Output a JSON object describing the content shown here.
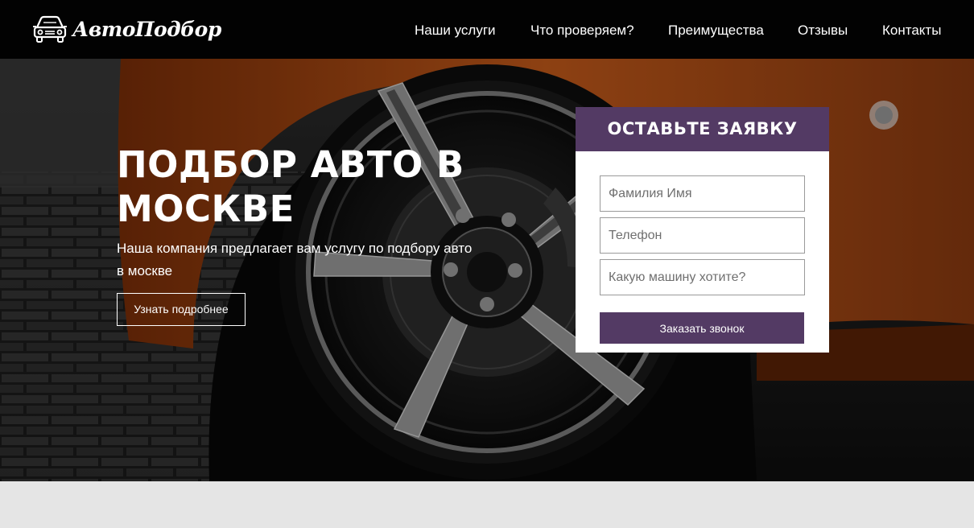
{
  "header": {
    "logo_text": "АвтоПодбор",
    "nav": [
      {
        "label": "Наши услуги"
      },
      {
        "label": "Что проверяем?"
      },
      {
        "label": "Преимущества"
      },
      {
        "label": "Отзывы"
      },
      {
        "label": "Контакты"
      }
    ]
  },
  "hero": {
    "title": "ПОДБОР АВТО В МОСКВЕ",
    "subtitle": "Наша компания предлагает вам услугу по подбору авто в москве",
    "button_label": "Узнать подробнее"
  },
  "form": {
    "heading": "ОСТАВЬТЕ ЗАЯВКУ",
    "name_placeholder": "Фамилия Имя",
    "phone_placeholder": "Телефон",
    "car_placeholder": "Какую машину хотите?",
    "submit_label": "Заказать звонок"
  },
  "colors": {
    "header_bg": "#020202",
    "accent": "#533a64",
    "car_orange": "#b5561a",
    "page_bg": "#e5e5e5"
  }
}
